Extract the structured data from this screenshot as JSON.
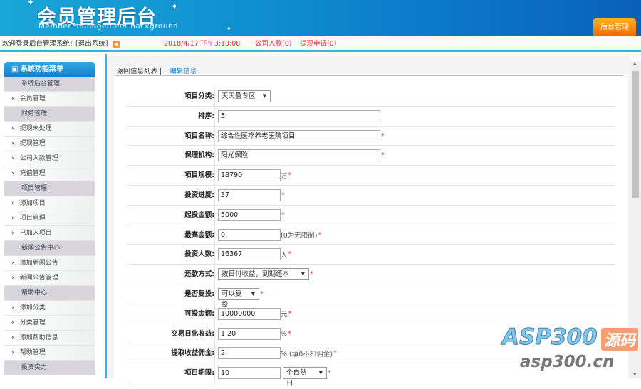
{
  "header": {
    "title": "会员管理后台",
    "subtitle": "Member management background",
    "admin_button": "后台管理"
  },
  "topbar": {
    "welcome": "欢迎登录后台管理系统!",
    "logout": "[退出系统]",
    "datetime": "2018/4/17 下午3:10:08",
    "company_deposit": "公司入款(0)",
    "withdraw_request": "提现申请(0)"
  },
  "sidebar": {
    "title": "系统功能菜单",
    "items": [
      {
        "label": "系统后台管理",
        "group": true
      },
      {
        "label": "会员管理",
        "group": false
      },
      {
        "label": "财务管理",
        "group": true
      },
      {
        "label": "提现未处理",
        "group": false
      },
      {
        "label": "提现管理",
        "group": false
      },
      {
        "label": "公司入款管理",
        "group": false
      },
      {
        "label": "充值管理",
        "group": false
      },
      {
        "label": "项目管理",
        "group": true
      },
      {
        "label": "添加项目",
        "group": false
      },
      {
        "label": "项目管理",
        "group": false
      },
      {
        "label": "已加入项目",
        "group": false
      },
      {
        "label": "新闻公告中心",
        "group": true
      },
      {
        "label": "添加新闻公告",
        "group": false
      },
      {
        "label": "新闻公告管理",
        "group": false
      },
      {
        "label": "帮助中心",
        "group": true
      },
      {
        "label": "添加分类",
        "group": false
      },
      {
        "label": "分类管理",
        "group": false
      },
      {
        "label": "添加帮助信息",
        "group": false
      },
      {
        "label": "帮助管理",
        "group": false
      },
      {
        "label": "投资实力",
        "group": true
      }
    ]
  },
  "tabs": {
    "back": "返回信息列表",
    "sep": "|",
    "edit": "编辑信息"
  },
  "form": [
    {
      "label": "项目分类:",
      "type": "select",
      "value": "天天盈专区",
      "w": 74,
      "req": false,
      "suffix": ""
    },
    {
      "label": "排序:",
      "type": "input",
      "value": "5",
      "w": 228,
      "req": false,
      "suffix": ""
    },
    {
      "label": "项目名称:",
      "type": "input",
      "value": "综合性医疗养老医院项目",
      "w": 228,
      "req": true,
      "suffix": ""
    },
    {
      "label": "保理机构:",
      "type": "input",
      "value": "阳光保险",
      "w": 228,
      "req": true,
      "suffix": ""
    },
    {
      "label": "项目规模:",
      "type": "input",
      "value": "18790",
      "w": 88,
      "req": true,
      "suffix": "万"
    },
    {
      "label": "投资进度:",
      "type": "input",
      "value": "37",
      "w": 88,
      "req": true,
      "suffix": ""
    },
    {
      "label": "起投金额:",
      "type": "input",
      "value": "5000",
      "w": 88,
      "req": true,
      "suffix": ""
    },
    {
      "label": "最高金额:",
      "type": "input",
      "value": "0",
      "w": 88,
      "req": true,
      "suffix": "(0为无限制)"
    },
    {
      "label": "投资人数:",
      "type": "input",
      "value": "16367",
      "w": 88,
      "req": true,
      "suffix": "人"
    },
    {
      "label": "还款方式:",
      "type": "select",
      "value": "按日付收益，到期还本",
      "w": 128,
      "req": true,
      "suffix": ""
    },
    {
      "label": "是否复投:",
      "type": "select",
      "value": "可以复投",
      "w": 58,
      "req": true,
      "suffix": ""
    },
    {
      "label": "可投金额:",
      "type": "input",
      "value": "10000000",
      "w": 88,
      "req": true,
      "suffix": "元"
    },
    {
      "label": "交易日化收益:",
      "type": "input",
      "value": "1.20",
      "w": 88,
      "req": true,
      "suffix": "%"
    },
    {
      "label": "提取收益佣金:",
      "type": "input",
      "value": "2",
      "w": 88,
      "req": true,
      "suffix": "% (填0不扣佣金)"
    },
    {
      "label": "项目期限:",
      "type": "input",
      "value": "10",
      "w": 88,
      "req": true,
      "suffix": "",
      "select2": "个自然日"
    }
  ],
  "watermark": {
    "brand": "ASP300",
    "tag": "源码",
    "url": "asp300.cn"
  }
}
